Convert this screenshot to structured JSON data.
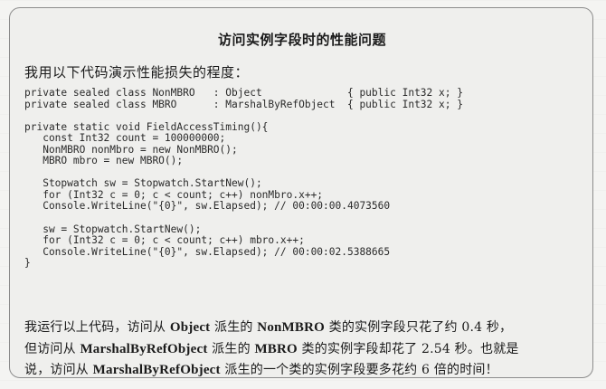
{
  "note": {
    "title": "访问实例字段时的性能问题",
    "intro": "我用以下代码演示性能损失的程度：",
    "code_lines": [
      "private sealed class NonMBRO   : Object              { public Int32 x; }",
      "private sealed class MBRO      : MarshalByRefObject  { public Int32 x; }",
      "",
      "private static void FieldAccessTiming(){",
      "   const Int32 count = 100000000;",
      "   NonMBRO nonMbro = new NonMBRO();",
      "   MBRO mbro = new MBRO();",
      "",
      "   Stopwatch sw = Stopwatch.StartNew();",
      "   for (Int32 c = 0; c < count; c++) nonMbro.x++;",
      "   Console.WriteLine(\"{0}\", sw.Elapsed); // 00:00:00.4073560",
      "",
      "   sw = Stopwatch.StartNew();",
      "   for (Int32 c = 0; c < count; c++) mbro.x++;",
      "   Console.WriteLine(\"{0}\", sw.Elapsed); // 00:00:02.5388665",
      "}"
    ],
    "desc": {
      "l1_a": "我运行以上代码，访问从 ",
      "l1_b": "Object",
      "l1_c": " 派生的 ",
      "l1_d": "NonMBRO",
      "l1_e": " 类的实例字段只花了约 0.4 秒，",
      "l2_a": "但访问从 ",
      "l2_b": "MarshalByRefObject",
      "l2_c": " 派生的 ",
      "l2_d": "MBRO",
      "l2_e": " 类的实例字段却花了 2.54 秒。也就是",
      "l3_a": "说，访问从 ",
      "l3_b": "MarshalByRefObject",
      "l3_c": " 派生的一个类的实例字段要多花约 6 倍的时间！"
    }
  }
}
